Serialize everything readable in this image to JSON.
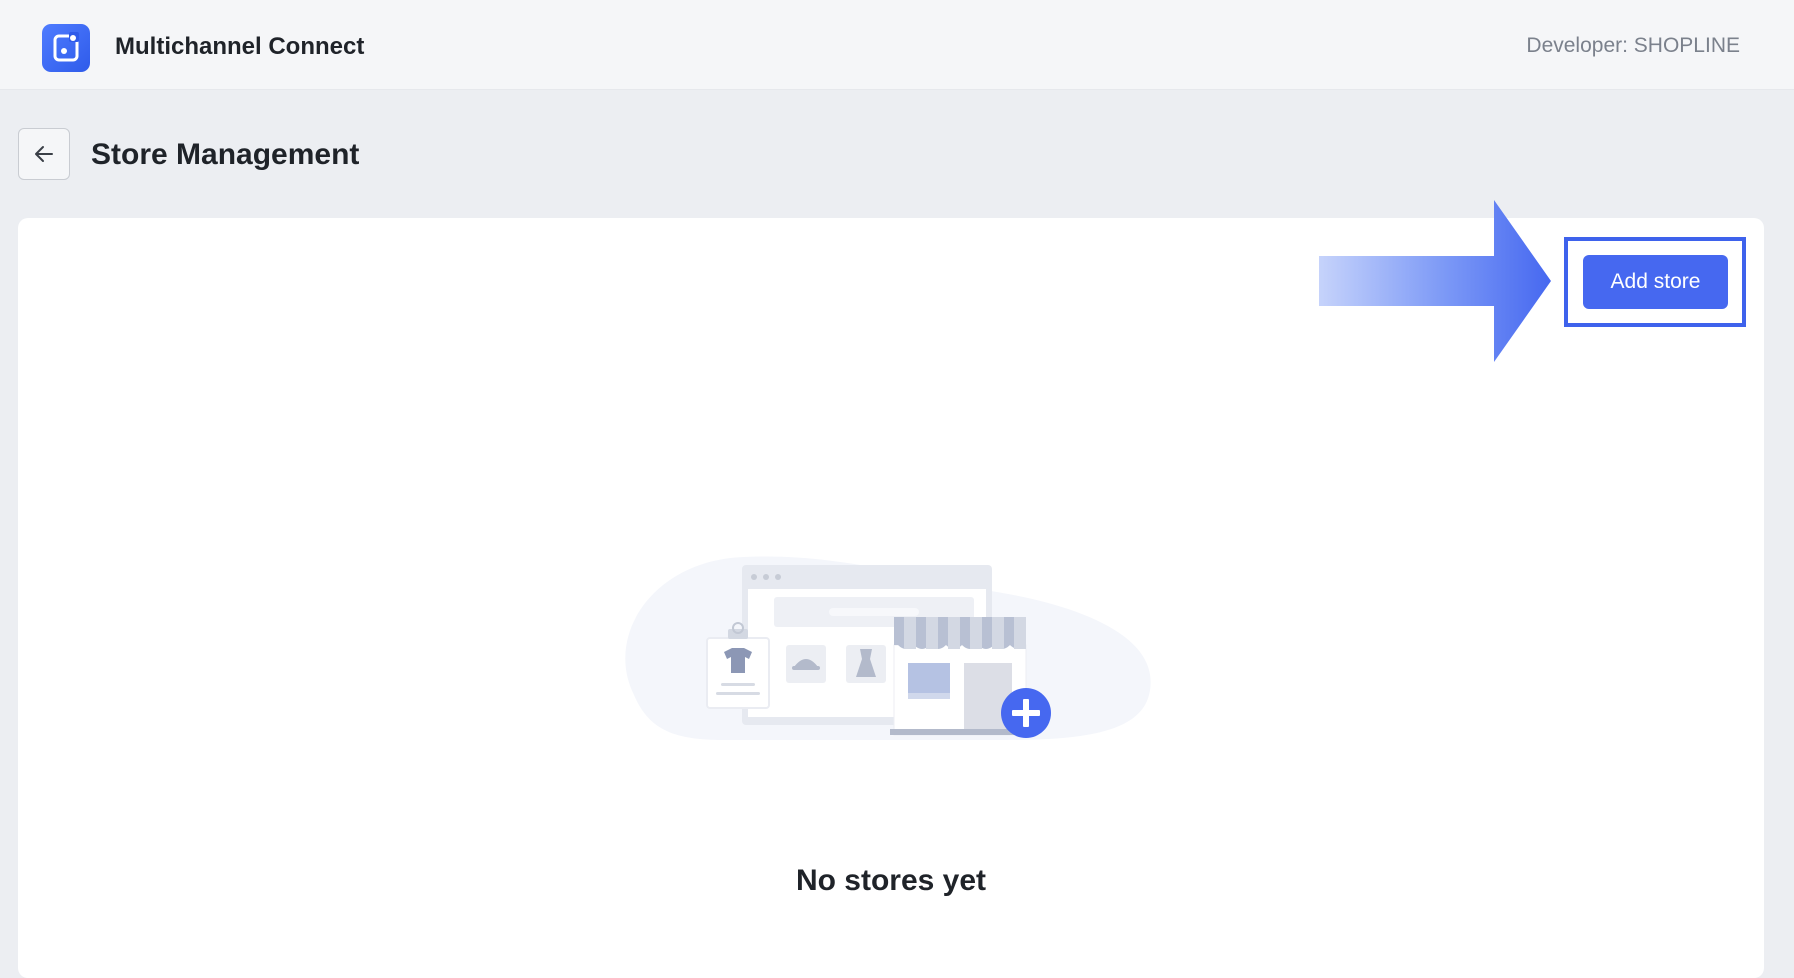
{
  "header": {
    "app_name": "Multichannel Connect",
    "developer_label": "Developer: SHOPLINE",
    "logo_icon": "app-logo-icon"
  },
  "page": {
    "title": "Store Management",
    "back_icon": "arrow-left-icon"
  },
  "toolbar": {
    "add_store_label": "Add store"
  },
  "empty_state": {
    "message": "No stores yet",
    "illustration": "store-illustration"
  },
  "colors": {
    "accent": "#4668f0",
    "highlight": "#3e62ec",
    "background": "#eceef2",
    "card": "#ffffff"
  }
}
